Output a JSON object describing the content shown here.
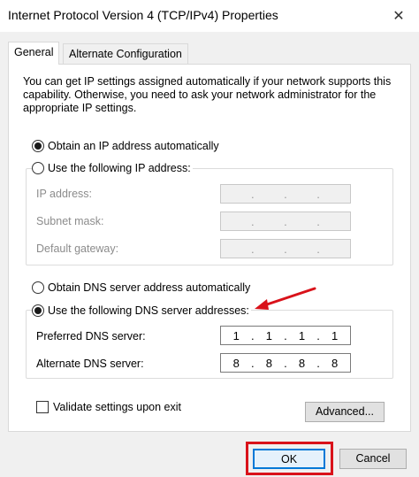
{
  "window": {
    "title": "Internet Protocol Version 4 (TCP/IPv4) Properties",
    "close_glyph": "✕"
  },
  "tabs": [
    {
      "label": "General",
      "active": true
    },
    {
      "label": "Alternate Configuration",
      "active": false
    }
  ],
  "description": "You can get IP settings assigned automatically if your network supports this capability. Otherwise, you need to ask your network administrator for the appropriate IP settings.",
  "ip_section": {
    "auto_label": "Obtain an IP address automatically",
    "auto_selected": true,
    "manual_label": "Use the following IP address:",
    "manual_selected": false,
    "fields": [
      {
        "label": "IP address:",
        "octets": [
          "",
          "",
          "",
          ""
        ],
        "enabled": false
      },
      {
        "label": "Subnet mask:",
        "octets": [
          "",
          "",
          "",
          ""
        ],
        "enabled": false
      },
      {
        "label": "Default gateway:",
        "octets": [
          "",
          "",
          "",
          ""
        ],
        "enabled": false
      }
    ]
  },
  "dns_section": {
    "auto_label": "Obtain DNS server address automatically",
    "auto_selected": false,
    "manual_label": "Use the following DNS server addresses:",
    "manual_selected": true,
    "fields": [
      {
        "label": "Preferred DNS server:",
        "octets": [
          "1",
          "1",
          "1",
          "1"
        ],
        "enabled": true
      },
      {
        "label": "Alternate DNS server:",
        "octets": [
          "8",
          "8",
          "8",
          "8"
        ],
        "enabled": true
      }
    ]
  },
  "validate_label": "Validate settings upon exit",
  "validate_checked": false,
  "buttons": {
    "advanced": "Advanced...",
    "ok": "OK",
    "cancel": "Cancel"
  },
  "annotations": {
    "highlight_color": "#d9121a"
  },
  "icons": {
    "close": "close-icon",
    "arrow": "red-arrow-annotation"
  }
}
